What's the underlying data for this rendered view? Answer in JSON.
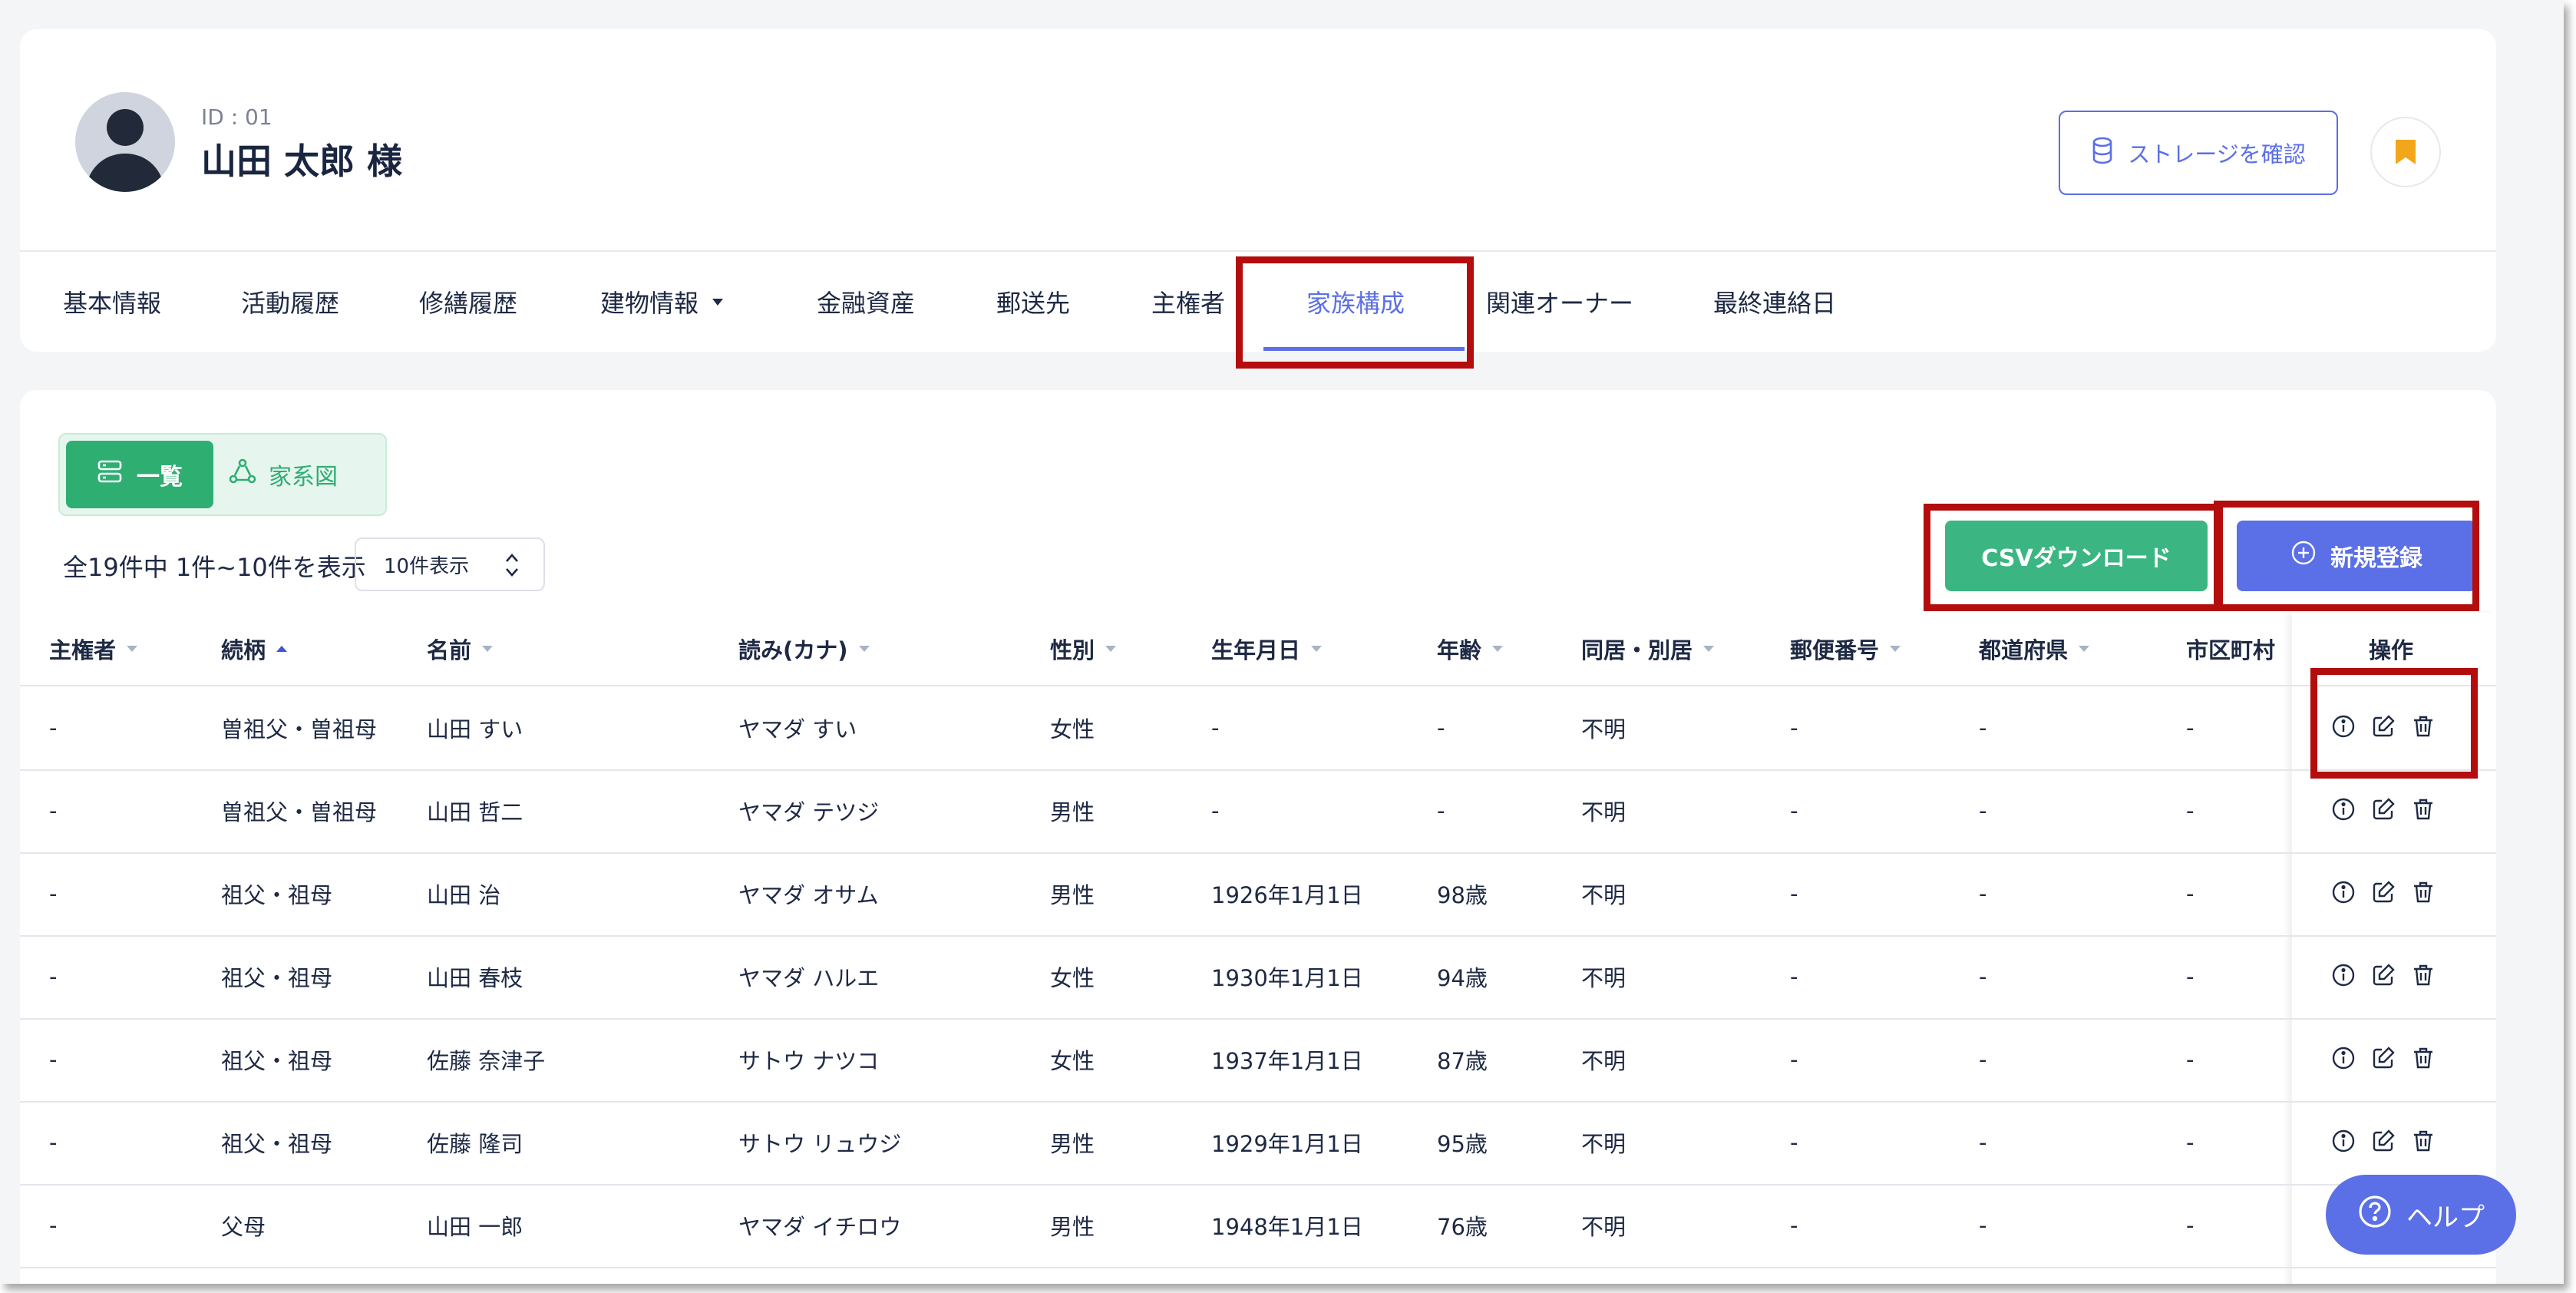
{
  "customer": {
    "id_label": "ID : 01",
    "name": "山田 太郎 様",
    "storage_button": "ストレージを確認"
  },
  "tabs": [
    {
      "label": "基本情報"
    },
    {
      "label": "活動履歴"
    },
    {
      "label": "修繕履歴"
    },
    {
      "label": "建物情報"
    },
    {
      "label": "金融資産"
    },
    {
      "label": "郵送先"
    },
    {
      "label": "主権者"
    },
    {
      "label": "家族構成",
      "active": true
    },
    {
      "label": "関連オーナー"
    },
    {
      "label": "最終連絡日"
    }
  ],
  "view_toggle": {
    "list_label": "一覧",
    "tree_label": "家系図"
  },
  "pagination": {
    "summary": "全19件中 1件~10件を表示",
    "per_page": "10件表示"
  },
  "actions": {
    "csv_label": "CSVダウンロード",
    "new_label": "新規登録"
  },
  "table": {
    "columns": [
      "主権者",
      "続柄",
      "名前",
      "読み(カナ)",
      "性別",
      "生年月日",
      "年齢",
      "同居・別居",
      "郵便番号",
      "都道府県",
      "市区町村",
      "操作"
    ],
    "rows": [
      [
        "-",
        "曽祖父・曽祖母",
        "山田 すい",
        "ヤマダ すい",
        "女性",
        "-",
        "-",
        "不明",
        "-",
        "-",
        "-"
      ],
      [
        "-",
        "曽祖父・曽祖母",
        "山田 哲二",
        "ヤマダ テツジ",
        "男性",
        "-",
        "-",
        "不明",
        "-",
        "-",
        "-"
      ],
      [
        "-",
        "祖父・祖母",
        "山田 治",
        "ヤマダ オサム",
        "男性",
        "1926年1月1日",
        "98歳",
        "不明",
        "-",
        "-",
        "-"
      ],
      [
        "-",
        "祖父・祖母",
        "山田 春枝",
        "ヤマダ ハルエ",
        "女性",
        "1930年1月1日",
        "94歳",
        "不明",
        "-",
        "-",
        "-"
      ],
      [
        "-",
        "祖父・祖母",
        "佐藤 奈津子",
        "サトウ ナツコ",
        "女性",
        "1937年1月1日",
        "87歳",
        "不明",
        "-",
        "-",
        "-"
      ],
      [
        "-",
        "祖父・祖母",
        "佐藤 隆司",
        "サトウ リュウジ",
        "男性",
        "1929年1月1日",
        "95歳",
        "不明",
        "-",
        "-",
        "-"
      ],
      [
        "-",
        "父母",
        "山田 一郎",
        "ヤマダ イチロウ",
        "男性",
        "1948年1月1日",
        "76歳",
        "不明",
        "-",
        "-",
        "-"
      ]
    ]
  },
  "help": {
    "label": "ヘルプ"
  },
  "colors": {
    "primary": "#5b6fe6",
    "green": "#3bb682",
    "highlight": "#b30d0d",
    "bookmark": "#f2a71b"
  }
}
